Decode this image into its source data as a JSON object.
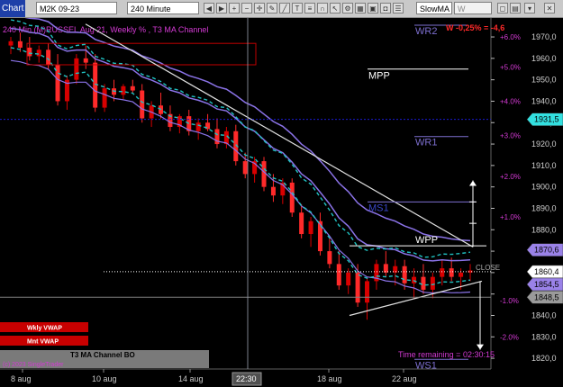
{
  "toolbar": {
    "chart_tab": "Chart",
    "symbol": "M2K 09-23",
    "interval": "240 Minute",
    "study": "SlowMA",
    "study2": "W VWAP",
    "icons": [
      "arrow-left-icon",
      "arrow-right-icon",
      "zoom-in-icon",
      "zoom-out-icon",
      "crosshair-icon",
      "pencil-icon",
      "line-icon",
      "text-icon",
      "fib-icon",
      "magnet-icon",
      "cursor-icon",
      "gear-icon",
      "grid-icon",
      "lock-icon",
      "camera-icon",
      "list-icon",
      "expand-icon",
      "chart-icon"
    ]
  },
  "chart_title": "240 Min (M)RUSSEL Aug 21, Weekly % , T3 MA Channel",
  "colors": {
    "up": "#d80000",
    "down": "#ff2a2a",
    "t3": "#8b73e8",
    "ma_channel": "#20c2c2",
    "level": "#7d6fd0",
    "mpp": "#ffffff",
    "vwap_box": "#c00000",
    "pct_axis": "#d43ad4",
    "price_axis": "#d0d0d0",
    "highlight_cyan": "#33e0e0"
  },
  "chart_data": {
    "type": "candlestick",
    "x_ticks": [
      "8 aug",
      "10 aug",
      "14 aug",
      "18 aug",
      "22 aug"
    ],
    "x_cursor_label": "22:30",
    "y_ticks": [
      1820,
      1830,
      1840,
      1850,
      1860,
      1870,
      1880,
      1890,
      1900,
      1910,
      1920,
      1930,
      1940,
      1950,
      1960,
      1970
    ],
    "y_range": [
      1815,
      1978
    ],
    "pct_ticks": [
      "6.0%",
      "5.0%",
      "4.0%",
      "3.0%",
      "2.0%",
      "1.0%",
      "-1.0%",
      "-2.0%"
    ],
    "pct_labels_prefix": "+",
    "levels": [
      {
        "name": "WR2",
        "value": 1975.5
      },
      {
        "name": "MPP",
        "value": 1955.0
      },
      {
        "name": "WR1",
        "value": 1923.5
      },
      {
        "name": "MS1",
        "value": 1893.0
      },
      {
        "name": "WPP",
        "value": 1872.5
      },
      {
        "name": "CLOSE",
        "value": 1860.4
      },
      {
        "name": "WS1",
        "value": 1819.5
      }
    ],
    "weekly_change_label": "W -0,25% = -4,6",
    "price_tags": [
      {
        "label": "1931,5",
        "kind": "cyan"
      },
      {
        "label": "1870,6",
        "kind": "purple"
      },
      {
        "label": "1860,4",
        "kind": "white"
      },
      {
        "label": "1854,5",
        "kind": "purple"
      },
      {
        "label": "1848,5",
        "kind": "grey"
      }
    ],
    "time_remaining": "Time remaining = 02:30:15",
    "buttons": [
      "Wkly VWAP",
      "Mnt VWAP"
    ],
    "legend_bar": "T3 MA Channel BO",
    "legend_sub": "(c) 2023 SingleTrader",
    "candles": [
      [
        1966,
        1970,
        1962,
        1968
      ],
      [
        1968,
        1972,
        1963,
        1965
      ],
      [
        1965,
        1970,
        1959,
        1961
      ],
      [
        1961,
        1966,
        1958,
        1964
      ],
      [
        1964,
        1967,
        1955,
        1957
      ],
      [
        1957,
        1962,
        1938,
        1940
      ],
      [
        1940,
        1952,
        1936,
        1950
      ],
      [
        1950,
        1962,
        1948,
        1960
      ],
      [
        1960,
        1966,
        1955,
        1958
      ],
      [
        1958,
        1962,
        1935,
        1937
      ],
      [
        1937,
        1948,
        1935,
        1946
      ],
      [
        1946,
        1950,
        1940,
        1943
      ],
      [
        1943,
        1948,
        1941,
        1947
      ],
      [
        1947,
        1950,
        1944,
        1945
      ],
      [
        1945,
        1948,
        1930,
        1932
      ],
      [
        1932,
        1940,
        1928,
        1938
      ],
      [
        1938,
        1944,
        1932,
        1934
      ],
      [
        1934,
        1938,
        1926,
        1928
      ],
      [
        1928,
        1934,
        1925,
        1933
      ],
      [
        1933,
        1936,
        1924,
        1926
      ],
      [
        1926,
        1932,
        1922,
        1930
      ],
      [
        1930,
        1934,
        1926,
        1927
      ],
      [
        1927,
        1932,
        1918,
        1920
      ],
      [
        1920,
        1928,
        1918,
        1926
      ],
      [
        1926,
        1929,
        1910,
        1912
      ],
      [
        1912,
        1916,
        1904,
        1906
      ],
      [
        1906,
        1914,
        1902,
        1912
      ],
      [
        1912,
        1914,
        1898,
        1900
      ],
      [
        1900,
        1906,
        1893,
        1896
      ],
      [
        1896,
        1904,
        1892,
        1902
      ],
      [
        1902,
        1904,
        1886,
        1888
      ],
      [
        1888,
        1892,
        1876,
        1878
      ],
      [
        1878,
        1886,
        1872,
        1884
      ],
      [
        1884,
        1888,
        1868,
        1870
      ],
      [
        1870,
        1876,
        1862,
        1864
      ],
      [
        1864,
        1870,
        1852,
        1854
      ],
      [
        1854,
        1862,
        1850,
        1860
      ],
      [
        1860,
        1864,
        1844,
        1846
      ],
      [
        1846,
        1858,
        1838,
        1856
      ],
      [
        1856,
        1866,
        1852,
        1864
      ],
      [
        1864,
        1870,
        1858,
        1860
      ],
      [
        1860,
        1866,
        1854,
        1863
      ],
      [
        1863,
        1866,
        1852,
        1855
      ],
      [
        1855,
        1862,
        1848,
        1858
      ],
      [
        1858,
        1864,
        1850,
        1852
      ],
      [
        1852,
        1860,
        1848,
        1858
      ],
      [
        1858,
        1866,
        1854,
        1862
      ],
      [
        1862,
        1867,
        1856,
        1858
      ],
      [
        1858,
        1862,
        1852,
        1860
      ],
      [
        1860,
        1864,
        1856,
        1861
      ]
    ]
  }
}
